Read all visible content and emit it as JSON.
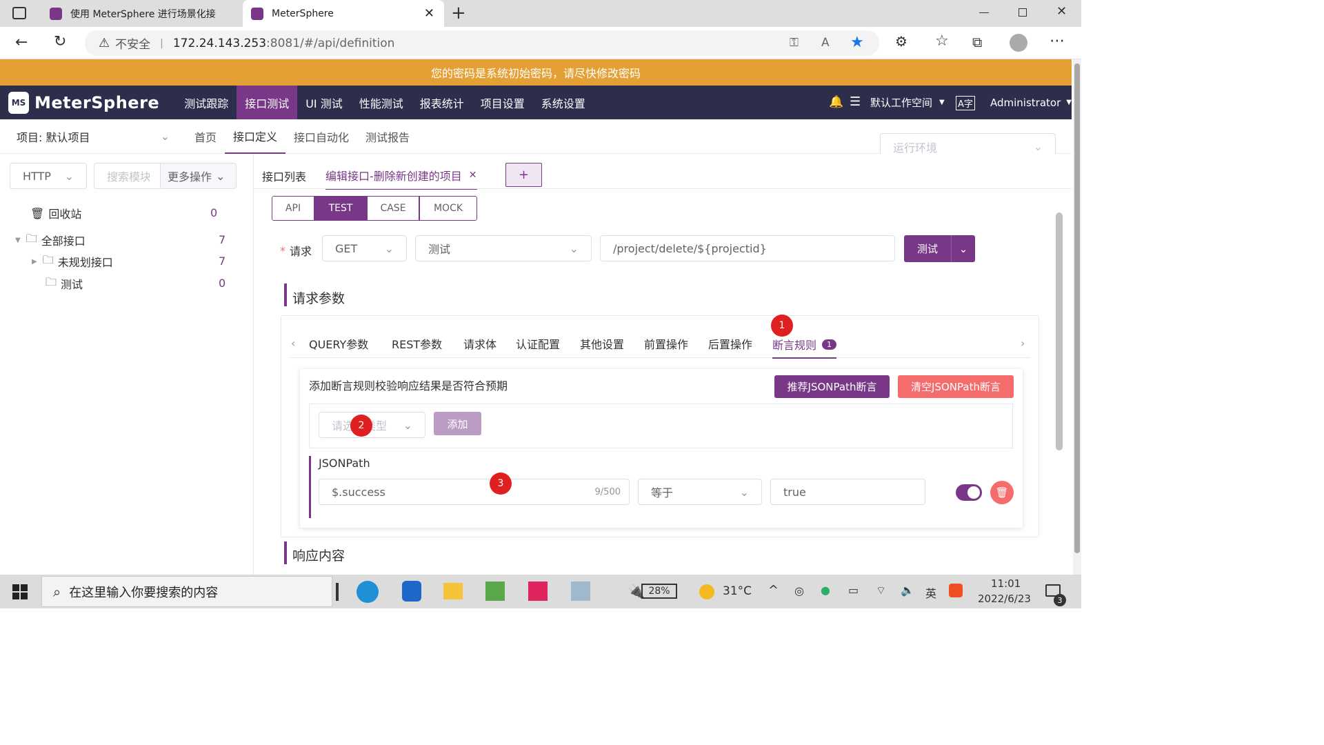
{
  "browser": {
    "tabs": [
      {
        "title": "使用 MeterSphere 进行场景化接"
      },
      {
        "title": "MeterSphere"
      }
    ],
    "security_label": "不安全",
    "url_host": "172.24.143.253",
    "url_path": ":8081/#/api/definition"
  },
  "banner": {
    "text": "您的密码是系统初始密码，请尽快修改密码",
    "color": "#e5a035"
  },
  "header": {
    "logo_text": "MeterSphere",
    "nav": [
      "测试跟踪",
      "接口测试",
      "UI 测试",
      "性能测试",
      "报表统计",
      "项目设置",
      "系统设置"
    ],
    "active_nav": "接口测试",
    "workspace": "默认工作空间",
    "user": "Administrator",
    "brand_color": "#783887",
    "bg_color": "#2d2e4c"
  },
  "subnav": {
    "project_label": "项目: 默认项目",
    "items": [
      "首页",
      "接口定义",
      "接口自动化",
      "测试报告"
    ],
    "active": "接口定义",
    "env_placeholder": "运行环境"
  },
  "sidebar": {
    "protocol": "HTTP",
    "search_placeholder": "搜索模块",
    "more_label": "更多操作",
    "tree": [
      {
        "label": "回收站",
        "count": "0"
      },
      {
        "label": "全部接口",
        "count": "7"
      },
      {
        "label": "未规划接口",
        "count": "7"
      },
      {
        "label": "测试",
        "count": "0"
      }
    ]
  },
  "main": {
    "tabs": [
      "接口列表",
      "编辑接口-删除新创建的项目"
    ],
    "add_tab": "+",
    "modes": [
      "API",
      "TEST",
      "CASE",
      "MOCK"
    ],
    "active_mode": "TEST",
    "request": {
      "label": "请求",
      "method": "GET",
      "env": "测试",
      "path": "/project/delete/${projectid}",
      "test_button": "测试"
    },
    "params_title": "请求参数",
    "param_tabs": [
      "QUERY参数",
      "REST参数",
      "请求体",
      "认证配置",
      "其他设置",
      "前置操作",
      "后置操作",
      "断言规则"
    ],
    "assertion_badge": "1",
    "assertion": {
      "hint": "添加断言规则校验响应结果是否符合预期",
      "recommend_btn": "推荐JSONPath断言",
      "clear_btn": "清空JSONPath断言",
      "type_placeholder": "请选择类型",
      "add_btn": "添加",
      "rule_title": "JSONPath",
      "expression": "$.success",
      "char_count": "9/500",
      "operator": "等于",
      "expected": "true"
    },
    "response_title": "响应内容",
    "markers": [
      "1",
      "2",
      "3"
    ]
  },
  "taskbar": {
    "search_placeholder": "在这里输入你要搜索的内容",
    "battery": "28%",
    "weather": "31°C",
    "ime": "英",
    "time": "11:01",
    "date": "2022/6/23",
    "notif_count": "3"
  }
}
